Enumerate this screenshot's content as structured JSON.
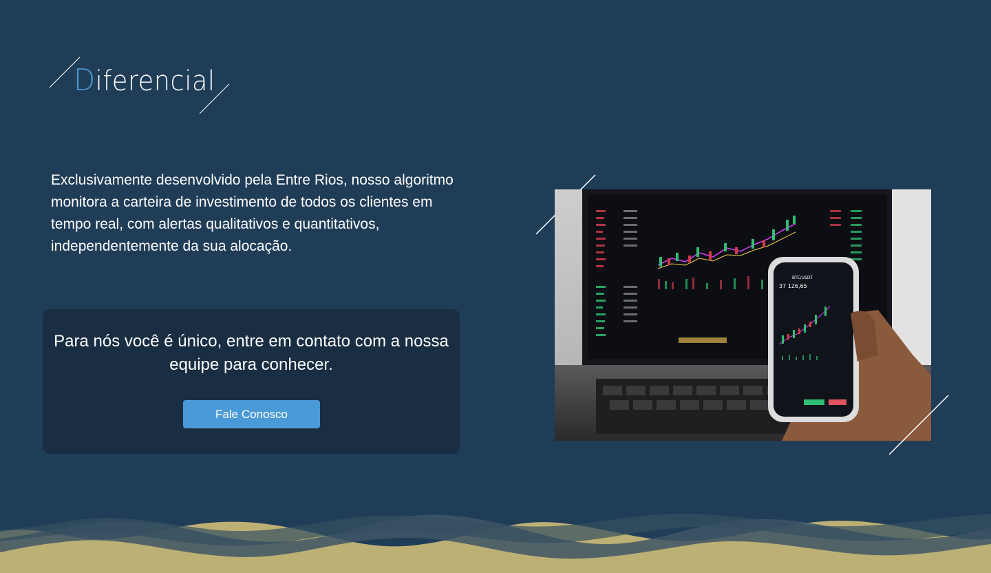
{
  "section": {
    "title_initial": "D",
    "title_rest": "iferencial"
  },
  "intro": {
    "text": "Exclusivamente desenvolvido pela Entre Rios, nosso algoritmo monitora a carteira de investimento de todos os clientes em tempo real, com alertas qualitativos e quantitativos, independentemente da sua alocação."
  },
  "cta": {
    "message": "Para nós você é único, entre em contato com a nossa equipe para conhecer.",
    "button_label": "Fale Conosco"
  },
  "phone_screen": {
    "symbol": "BTC/USDT",
    "price": "37 126,65"
  },
  "colors": {
    "background": "#203d58",
    "card": "#1a2e43",
    "accent": "#4b9ad8",
    "wave_sand": "#bdb074",
    "wave_overlay": "#3f5666"
  },
  "icons": {
    "photo": "trading-laptop-phone-photo",
    "decorative_lines": "diagonal-line-decoration"
  }
}
